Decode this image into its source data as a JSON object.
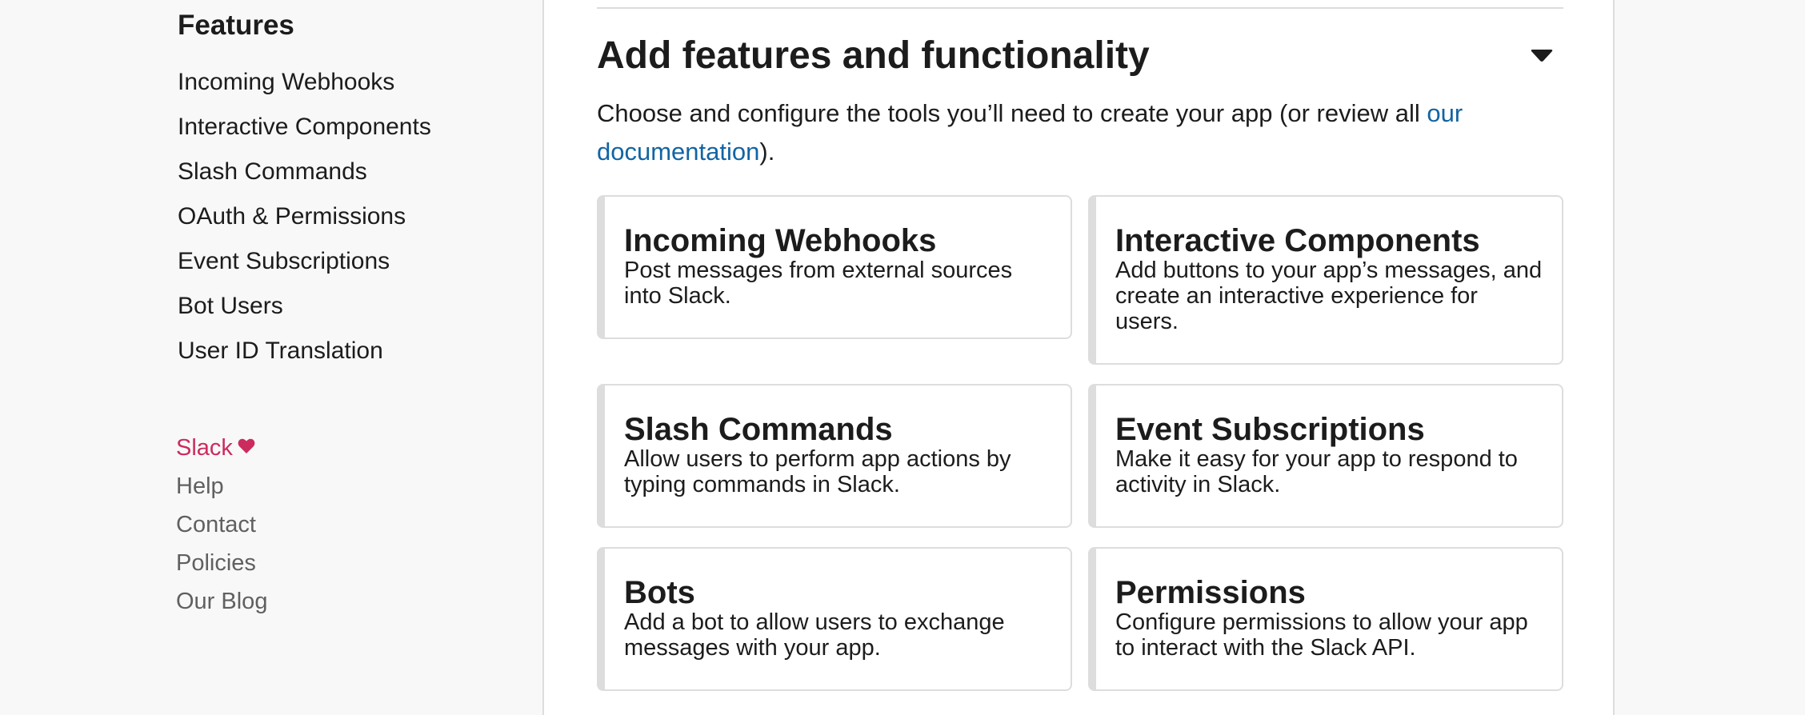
{
  "sidebar": {
    "heading": "Features",
    "items": [
      {
        "label": "Incoming Webhooks"
      },
      {
        "label": "Interactive Components"
      },
      {
        "label": "Slash Commands"
      },
      {
        "label": "OAuth & Permissions"
      },
      {
        "label": "Event Subscriptions"
      },
      {
        "label": "Bot Users"
      },
      {
        "label": "User ID Translation"
      }
    ],
    "footer": {
      "brand": "Slack",
      "links": [
        {
          "label": "Help"
        },
        {
          "label": "Contact"
        },
        {
          "label": "Policies"
        },
        {
          "label": "Our Blog"
        }
      ]
    }
  },
  "main": {
    "section_title": "Add features and functionality",
    "intro_text": "Choose and configure the tools you’ll need to create your app (or review all ",
    "intro_link": "our documentation",
    "intro_suffix": ").",
    "cards": [
      {
        "title": "Incoming Webhooks",
        "description": "Post messages from external sources into Slack."
      },
      {
        "title": "Interactive Components",
        "description": "Add buttons to your app’s messages, and create an interactive experience for users."
      },
      {
        "title": "Slash Commands",
        "description": "Allow users to perform app actions by typing commands in Slack."
      },
      {
        "title": "Event Subscriptions",
        "description": "Make it easy for your app to respond to activity in Slack."
      },
      {
        "title": "Bots",
        "description": "Add a bot to allow users to exchange messages with your app."
      },
      {
        "title": "Permissions",
        "description": "Configure permissions to allow your app to interact with the Slack API."
      }
    ]
  },
  "colors": {
    "link": "#1264a3",
    "brand": "#cc2b5e",
    "text": "#1d1c1d",
    "muted": "#616061",
    "border": "#dddddd"
  },
  "icons": {
    "brand_icon": "heart-icon",
    "toggle_icon": "caret-down-icon"
  }
}
